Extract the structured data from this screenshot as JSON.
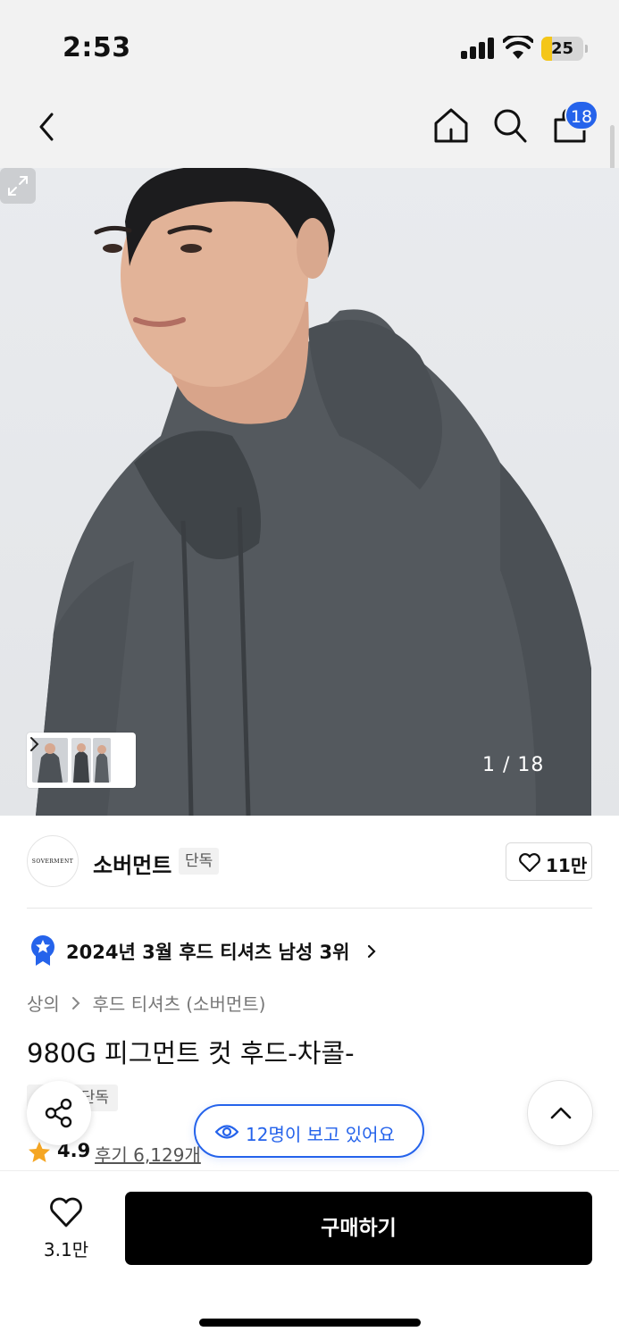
{
  "status_bar": {
    "time": "2:53",
    "battery_level": "25",
    "battery_fraction": 0.25,
    "battery_color": "#f4c619"
  },
  "nav": {
    "back_icon": "chevron-left-icon",
    "home_icon": "home-icon",
    "search_icon": "search-icon",
    "cart_icon": "shopping-bag-icon",
    "cart_badge": "18",
    "badge_color": "#2563eb"
  },
  "gallery": {
    "counter": "1 / 18",
    "expand_icon": "expand-icon",
    "thumbnail_arrow_icon": "chevron-right-icon"
  },
  "brand": {
    "logo_text": "SOVERMENT",
    "name": "소버먼트",
    "tag": "단독",
    "like_count": "11만"
  },
  "ranking": {
    "text": "2024년 3월 후드 티셔츠 남성 3위",
    "badge_icon": "ranking-ribbon-icon",
    "badge_color": "#2563eb"
  },
  "breadcrumb": {
    "items": [
      "상의",
      "후드 티셔츠 (소버먼트)"
    ]
  },
  "product": {
    "title": "980G 피그먼트 컷 후드-차콜-",
    "exclusive_tag": "단독",
    "rating": "4.9",
    "reviews": "후기 6,129개",
    "star_color": "#f5a623"
  },
  "viewers": {
    "text": "12명이 보고 있어요",
    "accent": "#2563eb"
  },
  "bottom_bar": {
    "wish_count": "3.1만",
    "buy_label": "구매하기"
  }
}
